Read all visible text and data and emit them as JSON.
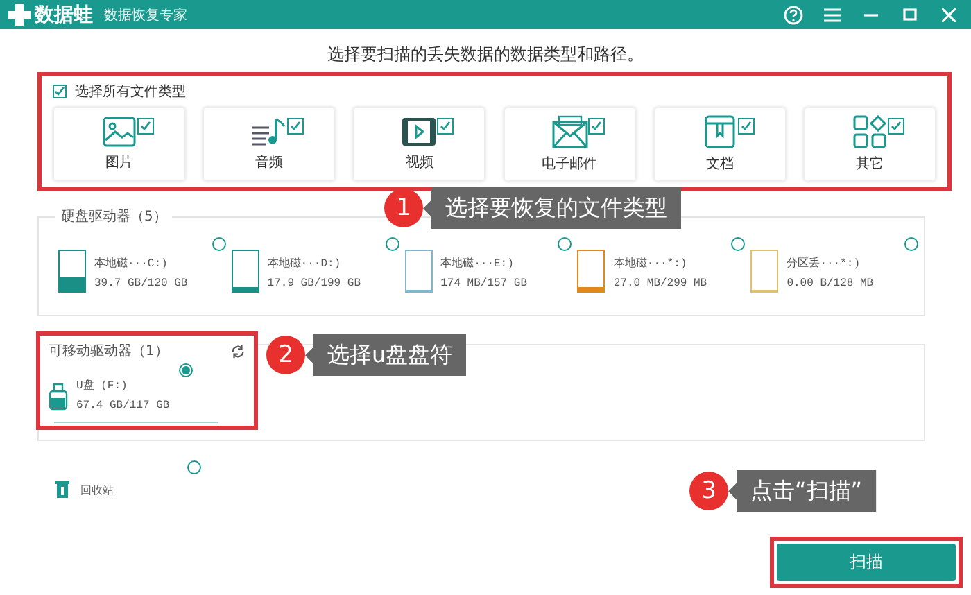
{
  "window": {
    "app_name": "数据蛙",
    "subtitle": "数据恢复专家"
  },
  "heading": "选择要扫描的丢失数据的数据类型和路径。",
  "file_types": {
    "select_all": {
      "label": "选择所有文件类型",
      "checked": true
    },
    "items": [
      {
        "kind": "image",
        "label": "图片",
        "checked": true
      },
      {
        "kind": "audio",
        "label": "音频",
        "checked": true
      },
      {
        "kind": "video",
        "label": "视频",
        "checked": true
      },
      {
        "kind": "email",
        "label": "电子邮件",
        "checked": true
      },
      {
        "kind": "document",
        "label": "文档",
        "checked": true
      },
      {
        "kind": "other",
        "label": "其它",
        "checked": true
      }
    ]
  },
  "hard_drives": {
    "title": "硬盘驱动器（5）",
    "items": [
      {
        "name": "本地磁···C:)",
        "usage": "39.7 GB/120 GB",
        "level": 0.33,
        "color": "#1a8f86",
        "selected": false
      },
      {
        "name": "本地磁···D:)",
        "usage": "17.9 GB/199 GB",
        "level": 0.09,
        "color": "#1a8f86",
        "selected": false
      },
      {
        "name": "本地磁···E:)",
        "usage": "174 MB/157 GB",
        "level": 0,
        "color": "#7fb6c9",
        "selected": false
      },
      {
        "name": "本地磁···*:)",
        "usage": "27.0 MB/299 MB",
        "level": 0.09,
        "color": "#e08a1e",
        "selected": false
      },
      {
        "name": "分区丢···*:)",
        "usage": "0.00  B/128 MB",
        "level": 0,
        "color": "#e0c070",
        "selected": false
      }
    ]
  },
  "removable_drives": {
    "title": "可移动驱动器（1）",
    "items": [
      {
        "name": "U盘 (F:)",
        "usage": "67.4 GB/117 GB",
        "selected": true
      }
    ]
  },
  "recycle_bin": {
    "label": "回收站",
    "selected": false
  },
  "scan_button": "扫描",
  "annotations": [
    {
      "number": "1",
      "text": "选择要恢复的文件类型"
    },
    {
      "number": "2",
      "text": "选择u盘盘符"
    },
    {
      "number": "3",
      "text": "点击“扫描”"
    }
  ]
}
